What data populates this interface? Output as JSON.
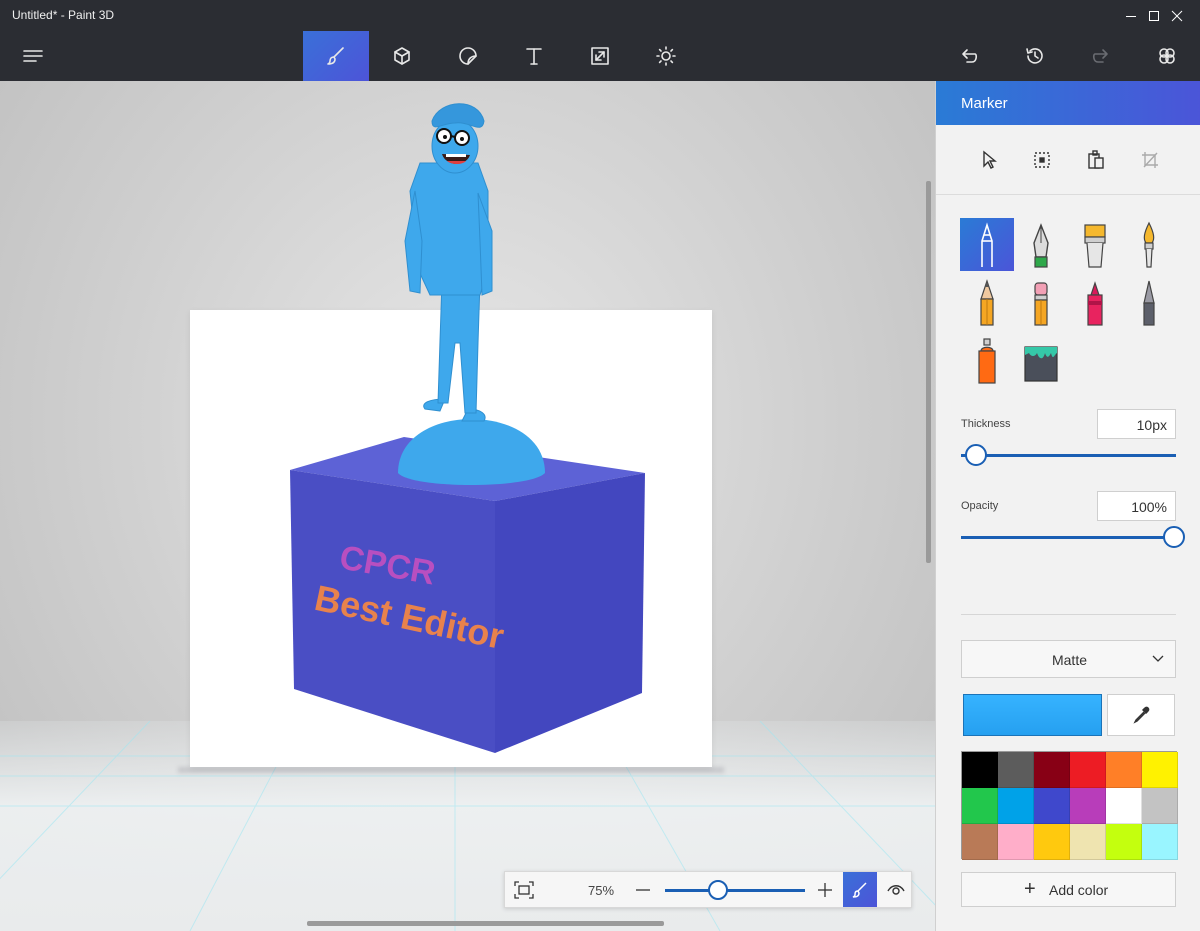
{
  "window": {
    "title": "Untitled* - Paint 3D"
  },
  "toolbar": {
    "menu_icon": "hamburger-menu-icon",
    "tools": [
      "brush-icon",
      "3d-cube-icon",
      "sticker-icon",
      "text-icon",
      "canvas-resize-icon",
      "effects-sun-icon"
    ],
    "actions": [
      "undo-icon",
      "history-icon",
      "redo-icon",
      "remix3d-icon"
    ]
  },
  "scene": {
    "text_line_1": "CPCR",
    "text_line_2": "Best Editor",
    "colors": {
      "figure": "#3ea8ec",
      "box_front": "#4a4ec4",
      "box_top": "#5d62d6",
      "text1": "#b84fc0",
      "text2": "#e8824c"
    }
  },
  "zoom": {
    "percent": "75%",
    "level": 0.38
  },
  "panel": {
    "title": "Marker",
    "thickness_label": "Thickness",
    "thickness_value": "10px",
    "thickness_level": 0.07,
    "opacity_label": "Opacity",
    "opacity_value": "100%",
    "opacity_level": 1.0,
    "material": "Matte",
    "add_color_label": "Add color",
    "current_color": "#26a0f0",
    "palette": [
      "#000000",
      "#5c5c5c",
      "#880015",
      "#ed1c24",
      "#ff7f27",
      "#fff200",
      "#22c74c",
      "#00a2e8",
      "#3f48cc",
      "#b83dba",
      "#ffffff",
      "#c3c3c3",
      "#b97a57",
      "#ffaec9",
      "#ffc90e",
      "#efe4b0",
      "#c4ff0e",
      "#99f5ff"
    ]
  }
}
